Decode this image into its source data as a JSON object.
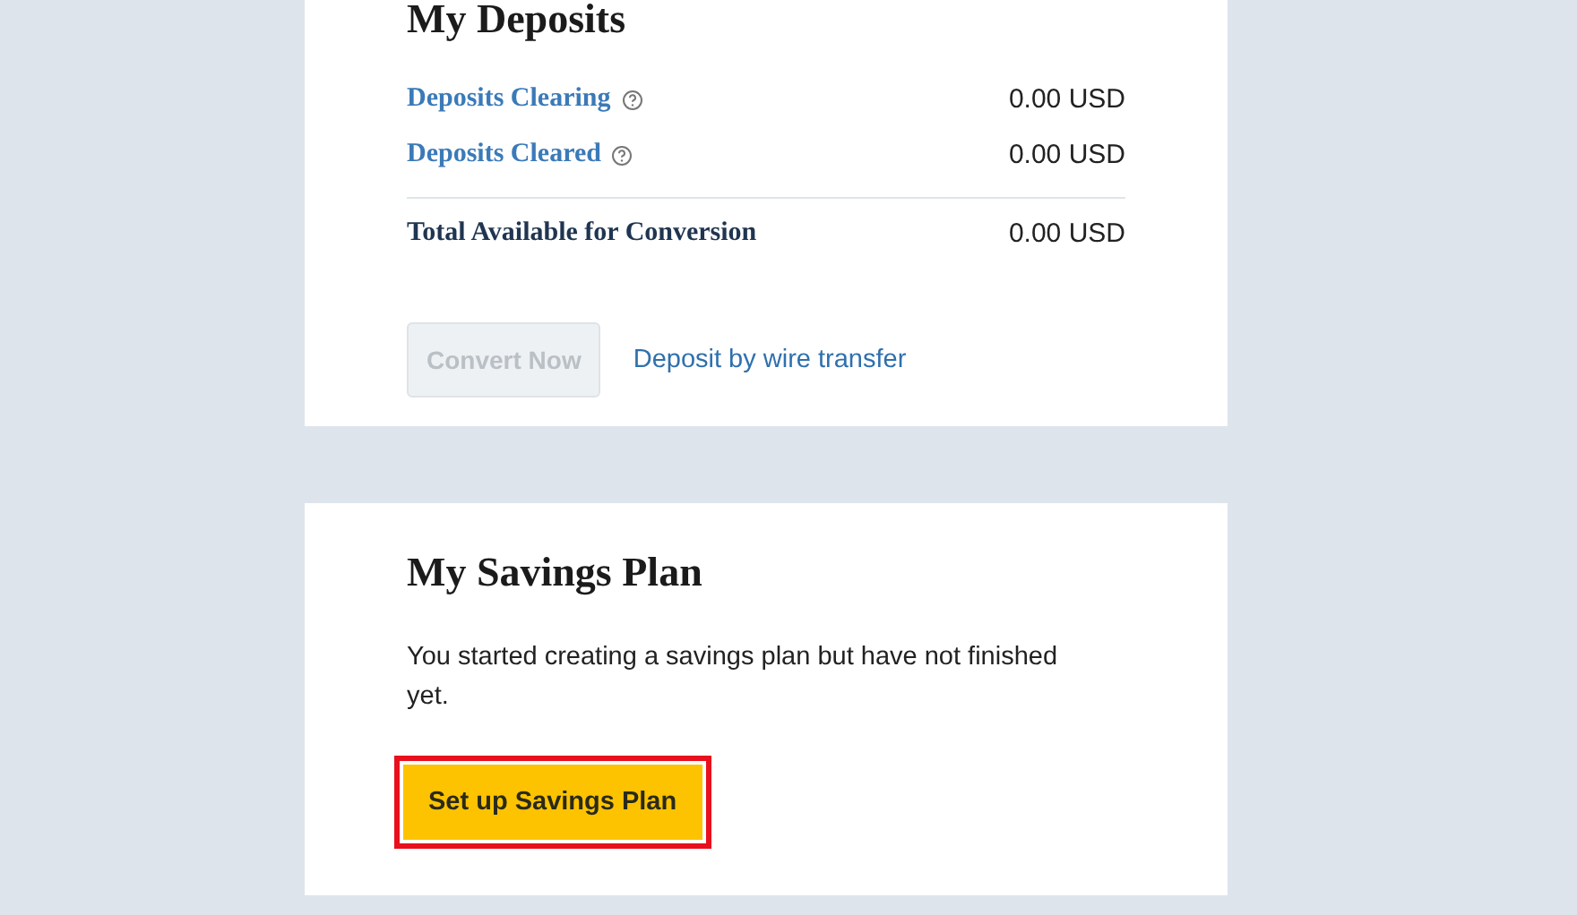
{
  "deposits": {
    "title": "My Deposits",
    "rows": [
      {
        "kind": "info",
        "label": "Deposits Clearing",
        "value": "0.00 USD"
      },
      {
        "kind": "info",
        "label": "Deposits Cleared",
        "value": "0.00 USD"
      },
      {
        "kind": "total",
        "label": "Total Available for Conversion",
        "value": "0.00 USD"
      }
    ],
    "convert_button": {
      "label": "Convert Now",
      "disabled": true
    },
    "wire_link": "Deposit by wire transfer"
  },
  "savings": {
    "title": "My Savings Plan",
    "message": "You started creating a savings plan but have not finished yet.",
    "button": {
      "label": "Set up Savings Plan",
      "highlighted": true
    }
  }
}
